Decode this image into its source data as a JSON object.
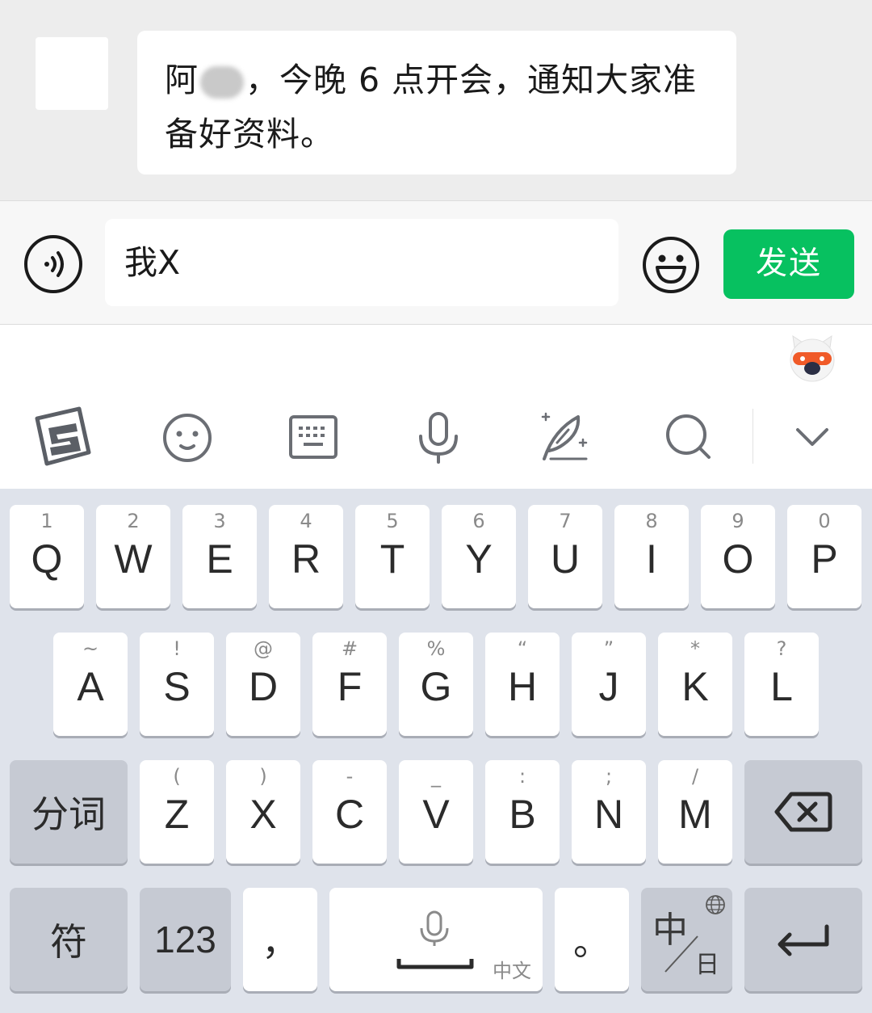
{
  "chat": {
    "message_before": "阿",
    "message_after": "，今晚 6 点开会，通知大家准备好资料。"
  },
  "input": {
    "value": "我X",
    "send_label": "发送"
  },
  "keyboard": {
    "row1": [
      {
        "hint": "1",
        "key": "Q"
      },
      {
        "hint": "2",
        "key": "W"
      },
      {
        "hint": "3",
        "key": "E"
      },
      {
        "hint": "4",
        "key": "R"
      },
      {
        "hint": "5",
        "key": "T"
      },
      {
        "hint": "6",
        "key": "Y"
      },
      {
        "hint": "7",
        "key": "U"
      },
      {
        "hint": "8",
        "key": "I"
      },
      {
        "hint": "9",
        "key": "O"
      },
      {
        "hint": "0",
        "key": "P"
      }
    ],
    "row2": [
      {
        "hint": "~",
        "key": "A"
      },
      {
        "hint": "!",
        "key": "S"
      },
      {
        "hint": "@",
        "key": "D"
      },
      {
        "hint": "#",
        "key": "F"
      },
      {
        "hint": "%",
        "key": "G"
      },
      {
        "hint": "“",
        "key": "H"
      },
      {
        "hint": "”",
        "key": "J"
      },
      {
        "hint": "*",
        "key": "K"
      },
      {
        "hint": "?",
        "key": "L"
      }
    ],
    "row3": [
      {
        "hint": "(",
        "key": "Z"
      },
      {
        "hint": ")",
        "key": "X"
      },
      {
        "hint": "-",
        "key": "C"
      },
      {
        "hint": "_",
        "key": "V"
      },
      {
        "hint": ":",
        "key": "B"
      },
      {
        "hint": ";",
        "key": "N"
      },
      {
        "hint": "/",
        "key": "M"
      }
    ],
    "segment_label": "分词",
    "symbol_label": "符",
    "number_label": "123",
    "comma_label": "，",
    "space_sub_label": "中文",
    "period_label": "。",
    "lang_main": "中",
    "lang_sub": "日"
  },
  "icons": {
    "voice": "voice-icon",
    "emoji": "emoji-icon",
    "sogou": "sogou-logo-icon",
    "toolbar_emoji": "smiley-icon",
    "keyboard": "keyboard-icon",
    "mic": "microphone-icon",
    "quill": "quill-icon",
    "search": "search-icon",
    "collapse": "chevron-down-icon",
    "backspace": "backspace-icon",
    "enter": "enter-icon",
    "globe": "globe-icon"
  },
  "colors": {
    "send": "#07c160",
    "keyboard_bg": "#dfe3eb",
    "chat_bg": "#ededed"
  }
}
